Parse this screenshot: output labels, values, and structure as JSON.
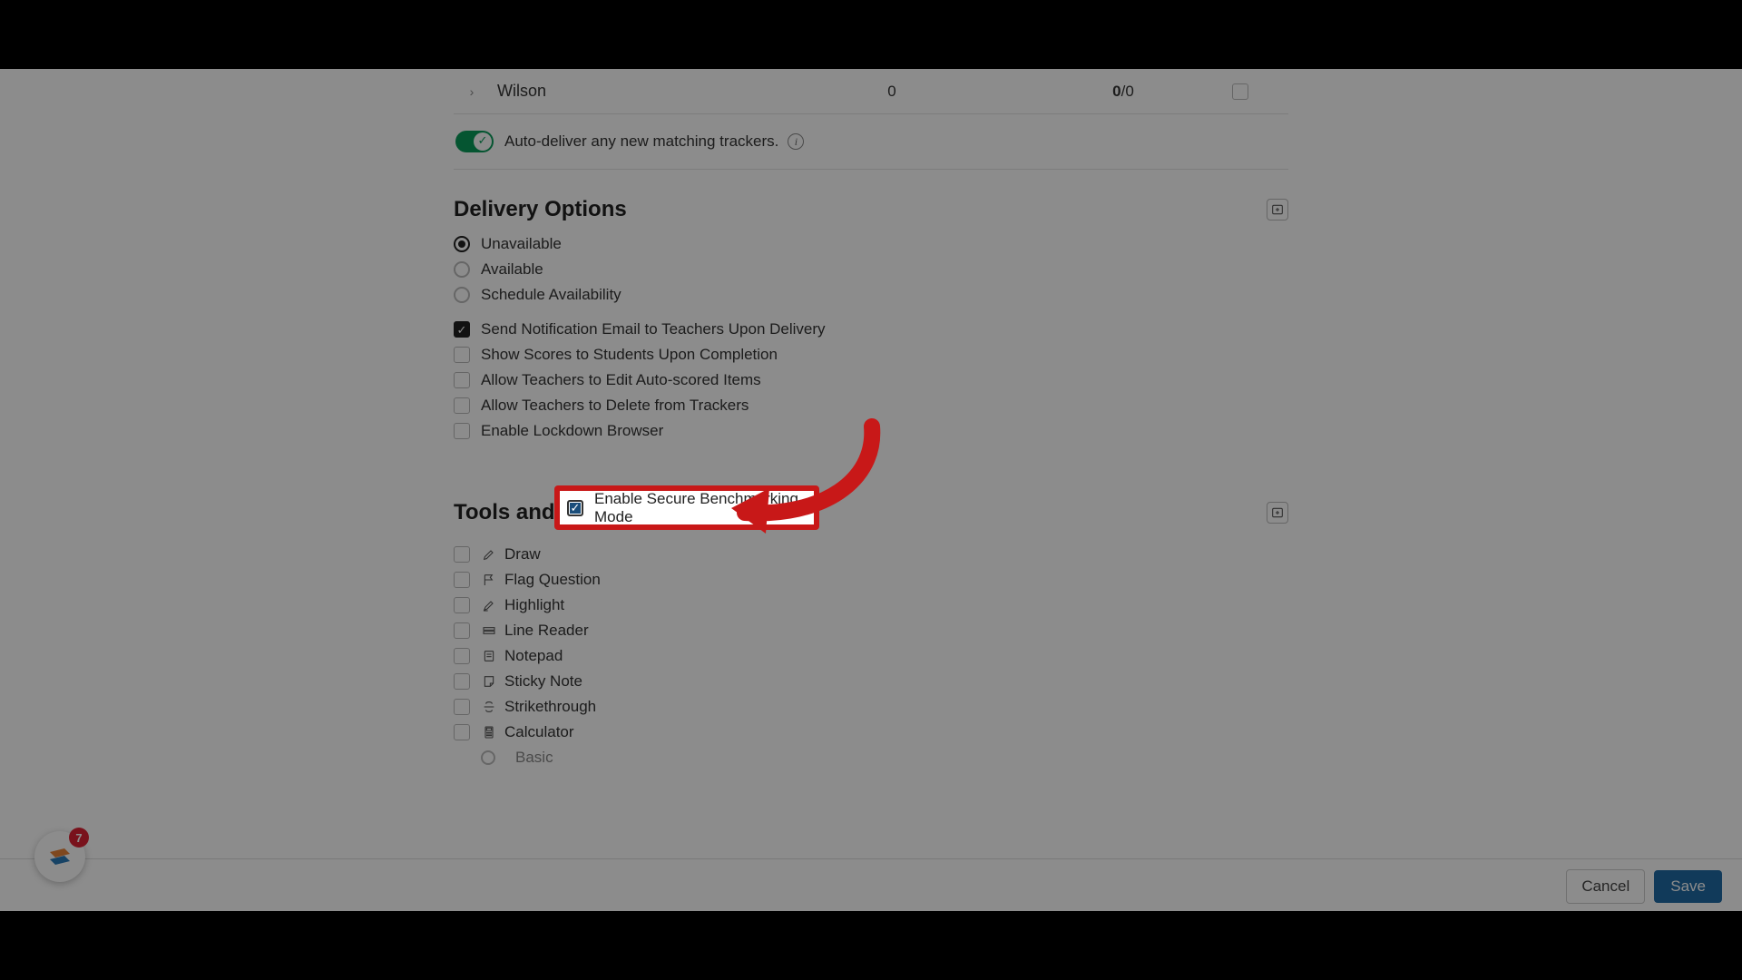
{
  "tracker_row": {
    "name": "Wilson",
    "count": "0",
    "score_bold": "0",
    "score_rest": "/0"
  },
  "auto_deliver": {
    "label": "Auto-deliver any new matching trackers."
  },
  "delivery": {
    "title": "Delivery Options",
    "radios": {
      "unavailable": "Unavailable",
      "available": "Available",
      "schedule": "Schedule Availability"
    },
    "checks": {
      "notify": "Send Notification Email to Teachers Upon Delivery",
      "show_scores": "Show Scores to Students Upon Completion",
      "allow_edit": "Allow Teachers to Edit Auto-scored Items",
      "allow_delete": "Allow Teachers to Delete from Trackers",
      "lockdown": "Enable Lockdown Browser",
      "benchmarking": "Enable Secure Benchmarking Mode"
    }
  },
  "tools": {
    "title": "Tools and Accommodations",
    "items": {
      "draw": "Draw",
      "flag": "Flag Question",
      "highlight": "Highlight",
      "line_reader": "Line Reader",
      "notepad": "Notepad",
      "sticky": "Sticky Note",
      "strike": "Strikethrough",
      "calculator": "Calculator",
      "basic": "Basic"
    }
  },
  "footer": {
    "cancel": "Cancel",
    "save": "Save"
  },
  "help": {
    "badge": "7"
  },
  "colors": {
    "highlight_border": "#c81818",
    "toggle_on": "#0a9b5a",
    "save_btn": "#1f6aa5"
  }
}
